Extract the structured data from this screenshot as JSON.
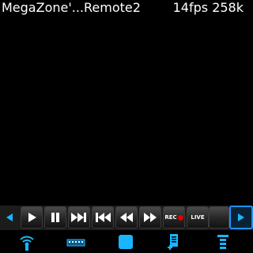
{
  "header": {
    "title": "MegaZone'...Remote2",
    "fps": "14fps",
    "bitrate": "258k"
  },
  "transport": {
    "buttons": [
      {
        "name": "play-icon"
      },
      {
        "name": "pause-icon"
      },
      {
        "name": "skip-forward-icon"
      },
      {
        "name": "skip-back-icon"
      },
      {
        "name": "rewind-icon"
      },
      {
        "name": "fast-forward-icon"
      },
      {
        "name": "record-button",
        "label": "REC"
      },
      {
        "name": "live-button",
        "label": "LIVE"
      }
    ],
    "record_label": "REC",
    "live_label": "LIVE"
  },
  "bottom_icons": [
    "wifi-antenna-icon",
    "keyboard-icon",
    "stop-square-icon",
    "add-document-icon",
    "list-menu-icon"
  ],
  "colors": {
    "background": "#000000",
    "accent": "#1e90ff",
    "icon_cyan": "#19b6ff",
    "record": "#e00000"
  }
}
